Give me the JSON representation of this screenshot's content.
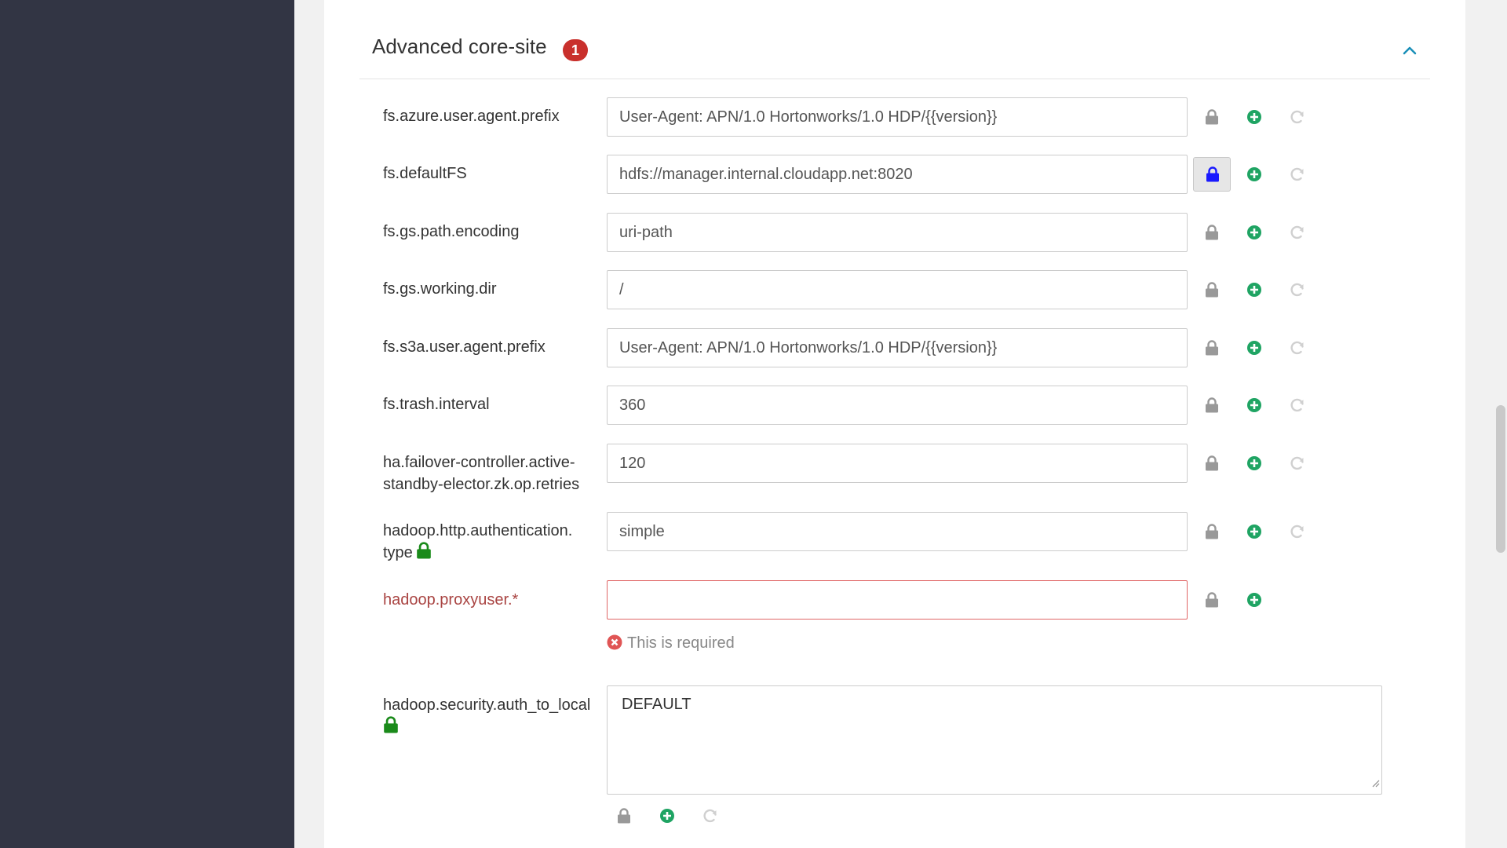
{
  "section": {
    "title": "Advanced core-site",
    "badge": "1"
  },
  "properties": [
    {
      "name": "fs.azure.user.agent.prefix",
      "value": "User-Agent: APN/1.0 Hortonworks/1.0 HDP/{{version}}"
    },
    {
      "name": "fs.defaultFS",
      "value": "hdfs://manager.internal.cloudapp.net:8020"
    },
    {
      "name": "fs.gs.path.encoding",
      "value": "uri-path"
    },
    {
      "name": "fs.gs.working.dir",
      "value": "/"
    },
    {
      "name": "fs.s3a.user.agent.prefix",
      "value": "User-Agent: APN/1.0 Hortonworks/1.0 HDP/{{version}}"
    },
    {
      "name": "fs.trash.interval",
      "value": "360"
    },
    {
      "name_line1": "ha.failover-controller.active-",
      "name_line2": "standby-elector.zk.op.retries",
      "value": "120"
    },
    {
      "name_line1": "hadoop.http.authentication.",
      "name_line2": "type",
      "value": "simple"
    },
    {
      "name": "hadoop.proxyuser.*",
      "value": "",
      "error": "This is required"
    },
    {
      "name": "hadoop.security.auth_to_local",
      "value": "DEFAULT"
    }
  ],
  "icons": {
    "lock": "lock-icon",
    "add": "plus-circle-icon",
    "undo": "refresh-icon",
    "collapse": "chevron-up-icon",
    "error": "times-circle-icon"
  },
  "colors": {
    "nav": "#323544",
    "badge": "#c9302c",
    "add_green": "#1fa463",
    "lock_blue": "#1a1aff",
    "label_lock_green": "#1a8a1a",
    "error_red": "#a94442",
    "chevron_blue": "#1a8fb8"
  }
}
